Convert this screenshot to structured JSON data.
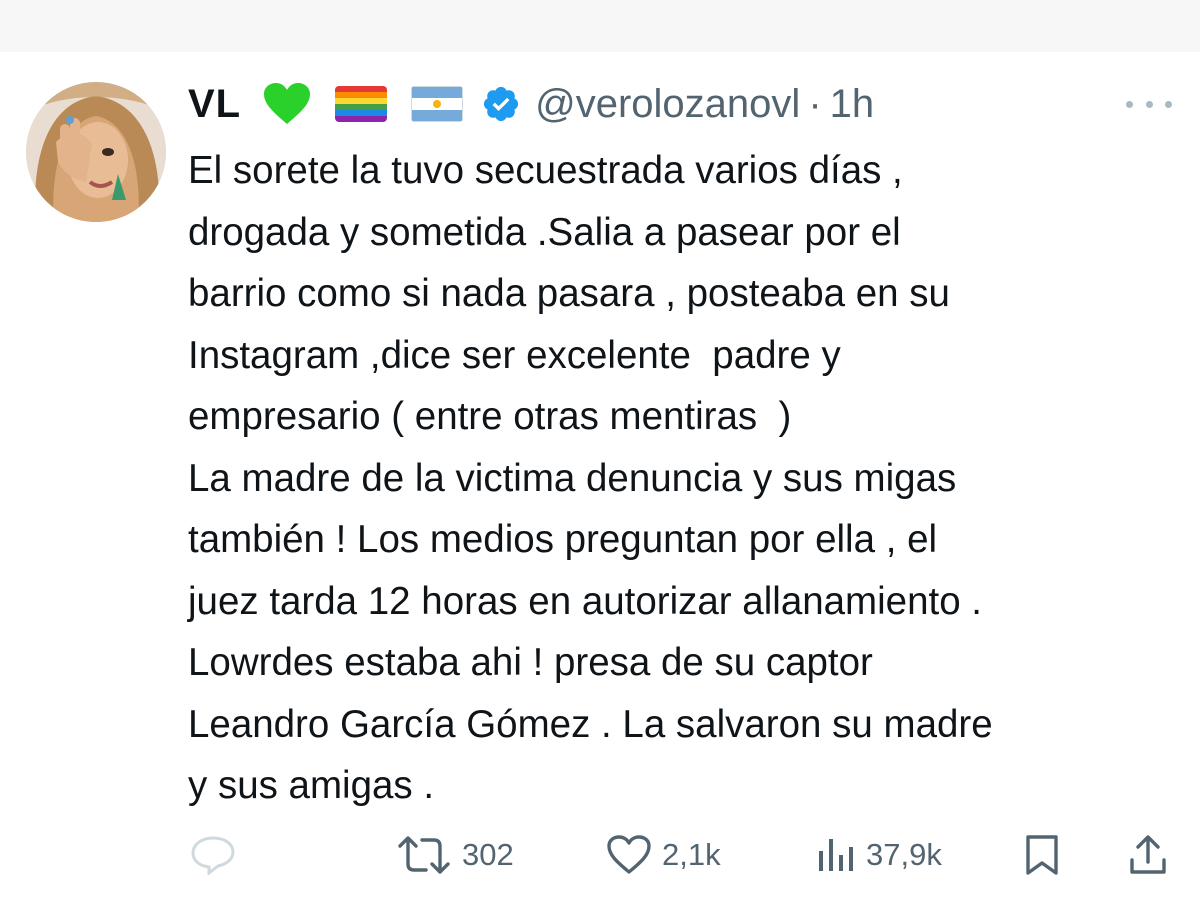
{
  "tweet": {
    "display_name": "VL",
    "handle": "@verolozanovl",
    "separator": "·",
    "time": "1h",
    "badges": [
      "green-heart-icon",
      "rainbow-flag-icon",
      "argentina-flag-icon",
      "verified-badge-icon"
    ],
    "lines": [
      "El sorete la tuvo secuestrada varios días ,",
      "drogada y sometida .Salia a pasear por el",
      "barrio como si nada pasara , posteaba en su",
      "Instagram ,dice ser excelente  padre y",
      "empresario ( entre otras mentiras  )",
      "La madre de la victima denuncia y sus migas",
      "también ! Los medios preguntan por ella , el",
      "juez tarda 12 horas en autorizar allanamiento .",
      "Lowrdes estaba ahi ! presa de su captor",
      "Leandro García Gómez . La salvaron su madre",
      "y sus amigas ."
    ]
  },
  "actions": {
    "reply_icon": "reply-icon",
    "retweets": "302",
    "likes": "2,1k",
    "views": "37,9k",
    "bookmark_icon": "bookmark-icon",
    "share_icon": "share-icon"
  },
  "colors": {
    "text": "#0f1419",
    "secondary": "#536471",
    "verified": "#1d9bf0",
    "heart_green": "#2bd12b"
  }
}
